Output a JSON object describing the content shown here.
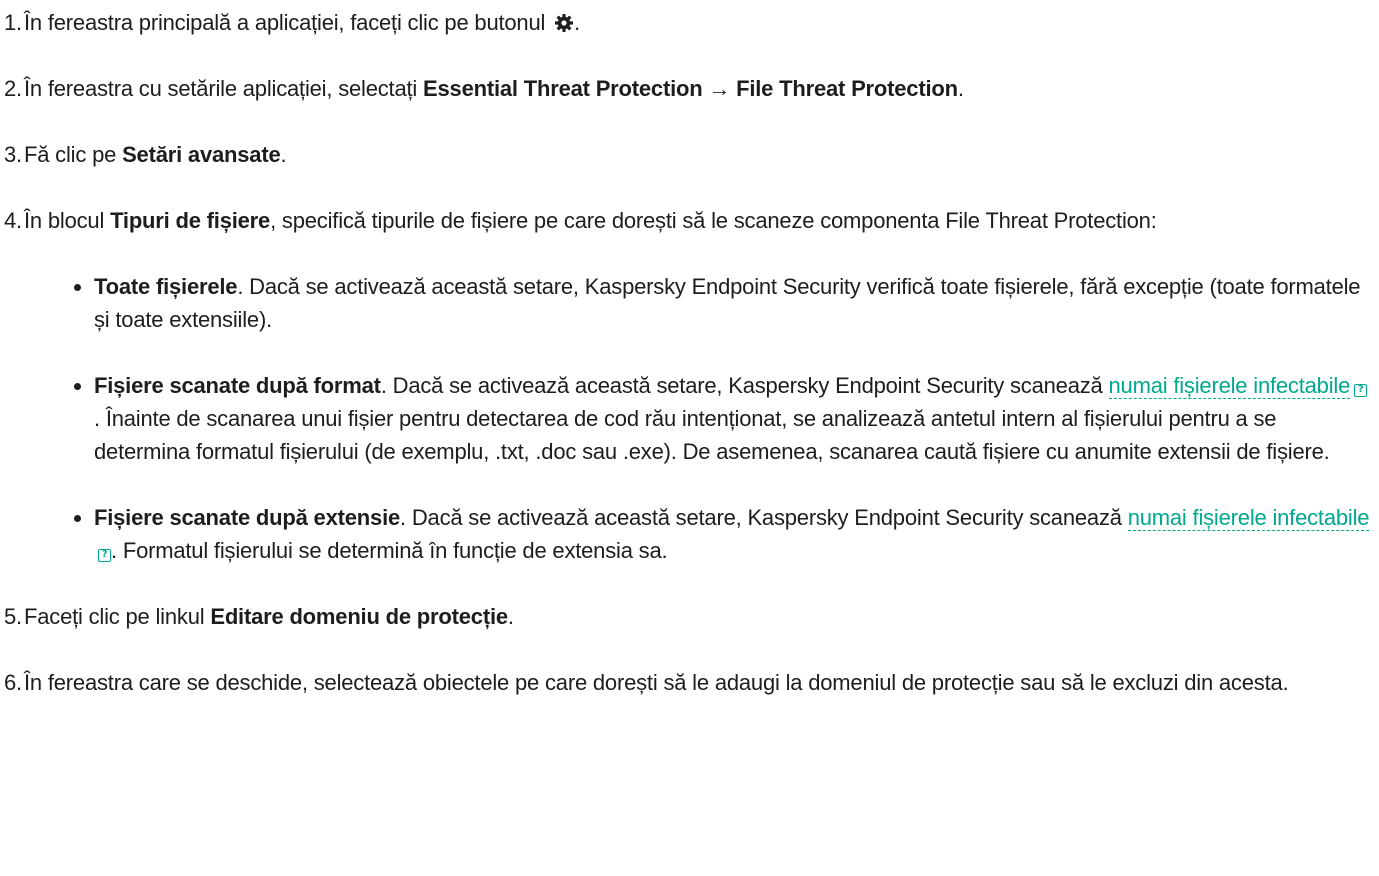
{
  "colors": {
    "text": "#1d1d1b",
    "link": "#00a88e",
    "background": "#ffffff"
  },
  "icons": {
    "settings": "gear-icon",
    "glossary": "question-icon"
  },
  "steps": [
    {
      "num": "1.",
      "text_before": "În fereastra principală a aplicației, faceți clic pe butonul",
      "text_after": "."
    },
    {
      "num": "2.",
      "text_before": "În fereastra cu setările aplicației, selectați ",
      "bold1": "Essential Threat Protection",
      "arrow": " → ",
      "bold2": "File Threat Protection",
      "text_after": "."
    },
    {
      "num": "3.",
      "text_before": "Fă clic pe ",
      "bold": "Setări avansate",
      "text_after": "."
    },
    {
      "num": "4.",
      "text_before": "În blocul ",
      "bold": "Tipuri de fișiere",
      "text_after": ", specifică tipurile de fișiere pe care dorești să le scaneze componenta File Threat Protection:",
      "options": [
        {
          "bold": "Toate fișierele",
          "text": ". Dacă se activează această setare, Kaspersky Endpoint Security verifică toate fișierele, fără excepție (toate formatele și toate extensiile)."
        },
        {
          "bold": "Fișiere scanate după format",
          "text_before_link": ". Dacă se activează această setare, Kaspersky Endpoint Security scanează ",
          "link": "numai fișierele infectabile",
          "text_after_link": ". Înainte de scanarea unui fișier pentru detectarea de cod rău intenționat, se analizează antetul intern al fișierului pentru a se determina formatul fișierului (de exemplu, .txt, .doc sau .exe). De asemenea, scanarea caută fișiere cu anumite extensii de fișiere."
        },
        {
          "bold": "Fișiere scanate după extensie",
          "text_before_link": ". Dacă se activează această setare, Kaspersky Endpoint Security scanează ",
          "link": "numai fișierele infectabile",
          "text_after_link": ". Formatul fișierului se determină în funcție de extensia sa."
        }
      ]
    },
    {
      "num": "5.",
      "text_before": "Faceți clic pe linkul ",
      "bold": "Editare domeniu de protecție",
      "text_after": "."
    },
    {
      "num": "6.",
      "text_before": "În fereastra care se deschide, selectează obiectele pe care dorești să le adaugi la domeniul de protecție sau să le excluzi din acesta."
    }
  ]
}
